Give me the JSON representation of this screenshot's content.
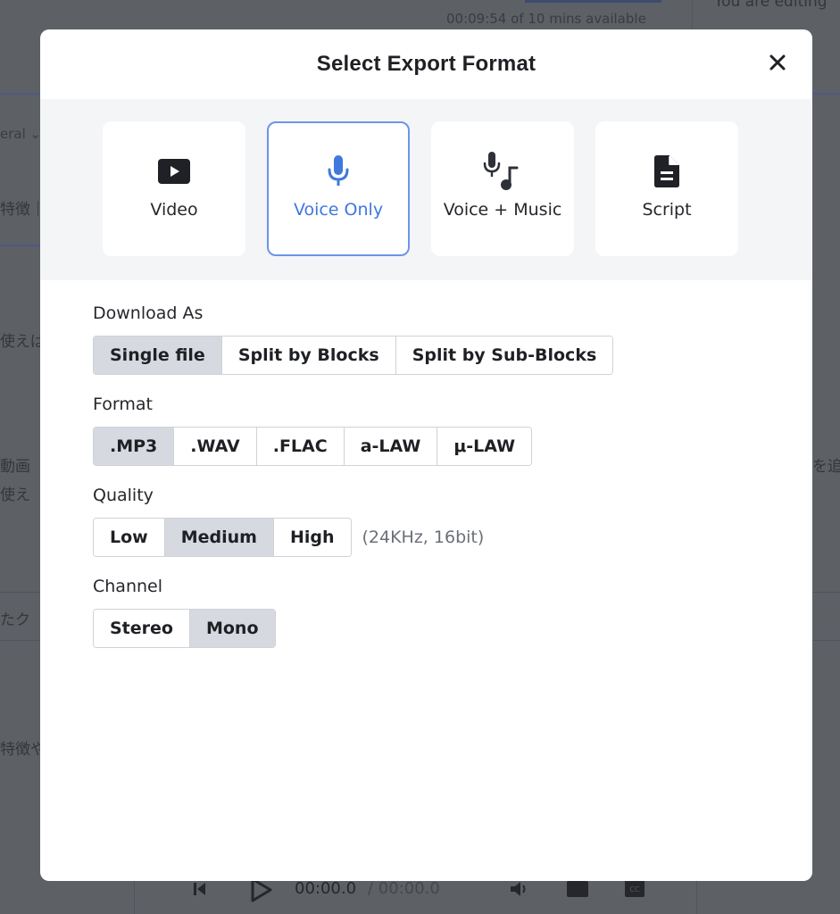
{
  "background": {
    "usage_text": "00:09:54 of 10 mins available",
    "editing_text": "You are editing",
    "dropdown_fragment": "eral",
    "jp_fragments": [
      "特徴｜",
      "使えば",
      "動画",
      "使え",
      "たク",
      "特徴や",
      "を追"
    ],
    "player": {
      "current_time": "00:00.0",
      "separator_total": "/ 00:00.0"
    }
  },
  "modal": {
    "title": "Select Export Format",
    "close_icon": "close-icon",
    "export_types": [
      {
        "label": "Video",
        "icon": "video-play-icon",
        "selected": false
      },
      {
        "label": "Voice Only",
        "icon": "microphone-icon",
        "selected": true
      },
      {
        "label": "Voice + Music",
        "icon": "microphone-music-icon",
        "selected": false
      },
      {
        "label": "Script",
        "icon": "document-icon",
        "selected": false
      }
    ],
    "download_as": {
      "label": "Download As",
      "options": [
        "Single file",
        "Split by Blocks",
        "Split by Sub-Blocks"
      ],
      "selected": "Single file"
    },
    "format": {
      "label": "Format",
      "options": [
        ".MP3",
        ".WAV",
        ".FLAC",
        "a-LAW",
        "μ-LAW"
      ],
      "selected": ".MP3"
    },
    "quality": {
      "label": "Quality",
      "options": [
        "Low",
        "Medium",
        "High"
      ],
      "selected": "Medium",
      "hint": "(24KHz, 16bit)"
    },
    "channel": {
      "label": "Channel",
      "options": [
        "Stereo",
        "Mono"
      ],
      "selected": "Mono"
    }
  },
  "colors": {
    "accent": "#3f78de",
    "selected_border": "#6b95e8",
    "active_segment": "#d6d9df"
  }
}
